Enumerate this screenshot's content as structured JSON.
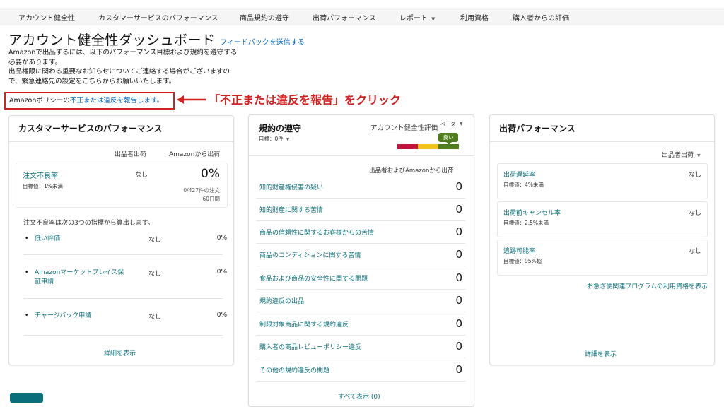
{
  "nav": {
    "items": [
      {
        "label": "アカウント健全性",
        "has_caret": false
      },
      {
        "label": "カスタマーサービスのパフォーマンス",
        "has_caret": false
      },
      {
        "label": "商品規約の遵守",
        "has_caret": false
      },
      {
        "label": "出荷パフォーマンス",
        "has_caret": false
      },
      {
        "label": "レポート",
        "has_caret": true
      },
      {
        "label": "利用資格",
        "has_caret": false
      },
      {
        "label": "購入者からの評価",
        "has_caret": false
      }
    ]
  },
  "header": {
    "title": "アカウント健全性ダッシュボード",
    "feedback_link": "フィードバックを送信する",
    "intro_1": "Amazonで出品するには、以下のパフォーマンス目標および規約を遵守する必要があります。",
    "intro_2": "出品権限に関わる重要なお知らせについてご連絡する場合がございますので、緊急連絡先の設定をこちらからお願いいたします。"
  },
  "policy": {
    "prefix": "Amazonポリシーの",
    "link": "不正または違反を報告します。"
  },
  "annotation": {
    "callout": "「不正または違反を報告」をクリック",
    "color": "#d21f1f"
  },
  "customer_service": {
    "title": "カスタマーサービスのパフォーマンス",
    "col_seller": "出品者出荷",
    "col_amazon": "Amazonから出荷",
    "odr": {
      "label": "注文不良率",
      "target": "目標値：1%未満",
      "seller_value": "なし",
      "amazon_value": "0%",
      "detail_1": "0/427件の注文",
      "detail_2": "60日間"
    },
    "explanation": "注文不良率は次の3つの指標から算出します。",
    "sub_metrics": [
      {
        "label": "低い評価",
        "status": "なし",
        "value": "0%"
      },
      {
        "label": "Amazonマーケットプレイス保証申請",
        "status": "なし",
        "value": "0%"
      },
      {
        "label": "チャージバック申請",
        "status": "なし",
        "value": "0%"
      }
    ],
    "details_link": "詳細を表示"
  },
  "compliance": {
    "title": "規約の遵守",
    "target_label": "目標：",
    "target_value": "0件",
    "rating_label": "アカウント健全性評価",
    "beta_label": "ベータ",
    "badge": "良い",
    "column_header": "出品者およびAmazonから出荷",
    "rows": [
      {
        "label": "知的財産権侵害の疑い",
        "value": "0"
      },
      {
        "label": "知的財産に関する苦情",
        "value": "0"
      },
      {
        "label": "商品の信頼性に関するお客様からの苦情",
        "value": "0"
      },
      {
        "label": "商品のコンディションに関する苦情",
        "value": "0"
      },
      {
        "label": "食品および商品の安全性に関する問題",
        "value": "0"
      },
      {
        "label": "規約違反の出品",
        "value": "0"
      },
      {
        "label": "制限対象商品に関する規約違反",
        "value": "0"
      },
      {
        "label": "購入者の商品レビューポリシー違反",
        "value": "0"
      },
      {
        "label": "その他の規約違反の問題",
        "value": "0"
      }
    ],
    "view_all": "すべて表示 (0)",
    "bar_colors": [
      "#c2143a",
      "#f0c419",
      "#4f7d1c"
    ]
  },
  "shipping": {
    "title": "出荷パフォーマンス",
    "col_seller": "出品者出荷",
    "metrics": [
      {
        "label": "出荷遅延率",
        "target": "目標値：4%未満",
        "value": "なし"
      },
      {
        "label": "出荷前キャンセル率",
        "target": "目標値：2.5%未満",
        "value": "なし"
      },
      {
        "label": "追跡可能率",
        "target": "目標値：95%超",
        "value": "なし"
      }
    ],
    "prime_link": "お急ぎ便関連プログラムの利用資格を表示",
    "details_link": "詳細を表示"
  }
}
